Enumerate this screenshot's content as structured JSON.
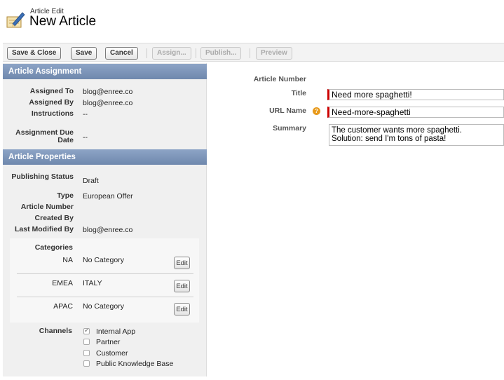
{
  "header": {
    "subtitle": "Article Edit",
    "title": "New Article",
    "logo_icon": "pencil-notepad-icon"
  },
  "toolbar": {
    "save_close": "Save & Close",
    "save": "Save",
    "cancel": "Cancel",
    "assign": "Assign...",
    "publish": "Publish...",
    "preview": "Preview"
  },
  "assignment": {
    "header": "Article Assignment",
    "assigned_to_label": "Assigned To",
    "assigned_to": "blog@enree.co",
    "assigned_by_label": "Assigned By",
    "assigned_by": "blog@enree.co",
    "instructions_label": "Instructions",
    "instructions": "--",
    "due_label": "Assignment Due Date",
    "due": "--"
  },
  "properties": {
    "header": "Article Properties",
    "status_label": "Publishing Status",
    "status": "Draft",
    "type_label": "Type",
    "type": "European Offer",
    "number_label": "Article Number",
    "created_by_label": "Created By",
    "modified_by_label": "Last Modified By",
    "modified_by": "blog@enree.co"
  },
  "categories": {
    "label": "Categories",
    "rows": [
      {
        "group": "NA",
        "value": "No Category",
        "edit": "Edit"
      },
      {
        "group": "EMEA",
        "value": "ITALY",
        "edit": "Edit"
      },
      {
        "group": "APAC",
        "value": "No Category",
        "edit": "Edit"
      }
    ]
  },
  "channels": {
    "label": "Channels",
    "items": [
      {
        "label": "Internal App",
        "checked": true
      },
      {
        "label": "Partner",
        "checked": false
      },
      {
        "label": "Customer",
        "checked": false
      },
      {
        "label": "Public Knowledge Base",
        "checked": false
      }
    ]
  },
  "form": {
    "article_number_label": "Article Number",
    "title_label": "Title",
    "title_value": "Need more spaghetti!",
    "url_label": "URL Name",
    "url_value": "Need-more-spaghetti",
    "summary_label": "Summary",
    "summary_value": "The customer wants more spaghetti.\nSolution: send I'm tons of pasta!"
  },
  "colors": {
    "section_header": "#7b93b8",
    "required": "#cc0000",
    "help": "#e89a1c"
  }
}
